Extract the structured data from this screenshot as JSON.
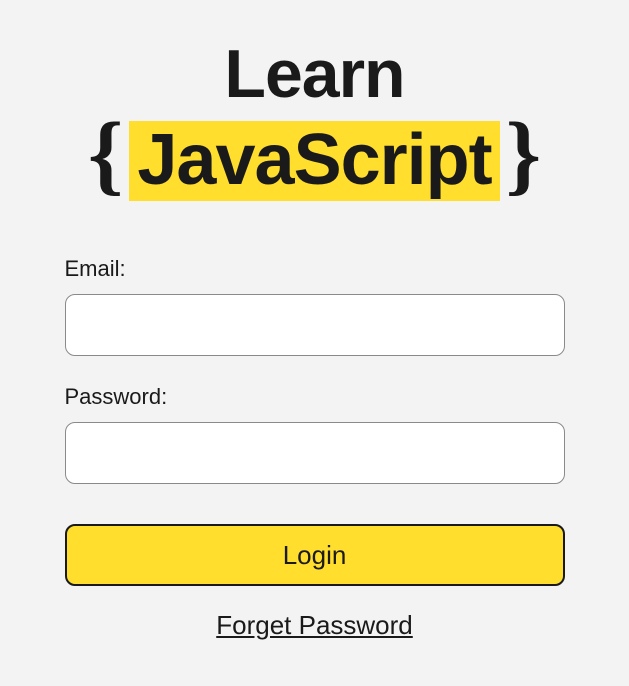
{
  "logo": {
    "line1": "Learn",
    "brace_left": "{",
    "highlighted": "JavaScript",
    "brace_right": "}"
  },
  "form": {
    "email_label": "Email:",
    "email_value": "",
    "password_label": "Password:",
    "password_value": "",
    "login_button": "Login",
    "forget_password": "Forget Password"
  },
  "colors": {
    "highlight": "#ffde2d",
    "text": "#1a1a1a",
    "background": "#f3f3f3",
    "input_bg": "#ffffff",
    "border": "#8a8a8a"
  }
}
